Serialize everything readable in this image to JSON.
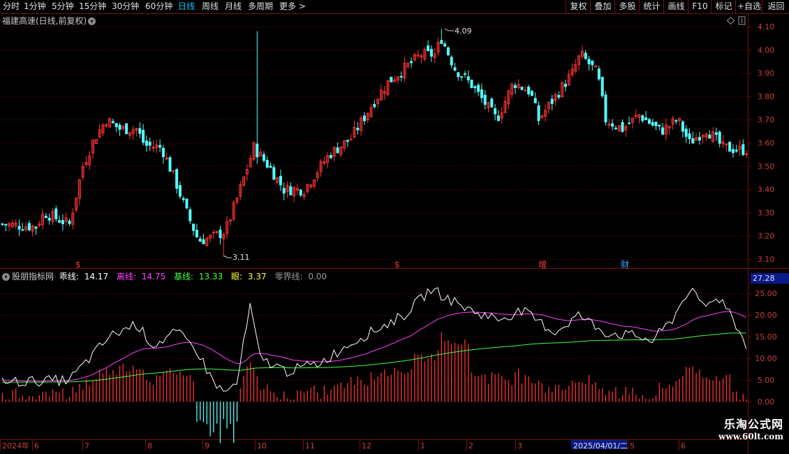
{
  "toolbar": {
    "periods": [
      "分时",
      "1分钟",
      "5分钟",
      "15分钟",
      "30分钟",
      "60分钟",
      "日线",
      "周线",
      "月线",
      "多周期",
      "更多"
    ],
    "active_period": "日线",
    "more_arrow": ">",
    "right_buttons": [
      "复权",
      "叠加",
      "多股",
      "统计",
      "画线",
      "F10",
      "标记",
      "+自选",
      "返回"
    ]
  },
  "stock": {
    "title": "福建高速(日线,前复权)"
  },
  "price_axis": {
    "labels": [
      "4.10",
      "4.00",
      "3.90",
      "3.80",
      "3.70",
      "3.60",
      "3.50",
      "3.40",
      "3.30",
      "3.20",
      "3.10"
    ]
  },
  "price_annotations": {
    "high": "4.09",
    "low": "3.11"
  },
  "event_marks": [
    {
      "label": "$",
      "color": "#ff3030"
    },
    {
      "label": "$",
      "color": "#ff3030"
    },
    {
      "label": "增",
      "color": "#ff4040"
    },
    {
      "label": "财",
      "color": "#40a0ff"
    }
  ],
  "indicator": {
    "name": "股朋指标网",
    "items": [
      {
        "label": "乖线:",
        "value": "14.17",
        "color": "#ffffff"
      },
      {
        "label": "离线:",
        "value": "14.75",
        "color": "#ff40ff"
      },
      {
        "label": "基线:",
        "value": "13.33",
        "color": "#40ff40"
      },
      {
        "label": "眼:",
        "value": "3.37",
        "color": "#ffff40"
      },
      {
        "label": "零界线:",
        "value": "0.00",
        "color": "#9a9a9a"
      }
    ],
    "axis_labels": [
      "25.00",
      "20.00",
      "15.00",
      "10.00",
      "5.00",
      "0.00"
    ],
    "current_tag": "27.28"
  },
  "date_axis": {
    "labels": [
      "2024年",
      "6",
      "7",
      "8",
      "9",
      "10",
      "11",
      "12",
      "1",
      "2",
      "3",
      "2025/04/01/二",
      "5",
      "6"
    ]
  },
  "watermark": {
    "title": "乐淘公式网",
    "url": "www.60lt.com"
  },
  "colors": {
    "up": "#ff3232",
    "down": "#54ffff",
    "grid": "#7a1010",
    "white_line": "#ffffff",
    "magenta": "#ff40ff",
    "green": "#40ff40"
  }
}
